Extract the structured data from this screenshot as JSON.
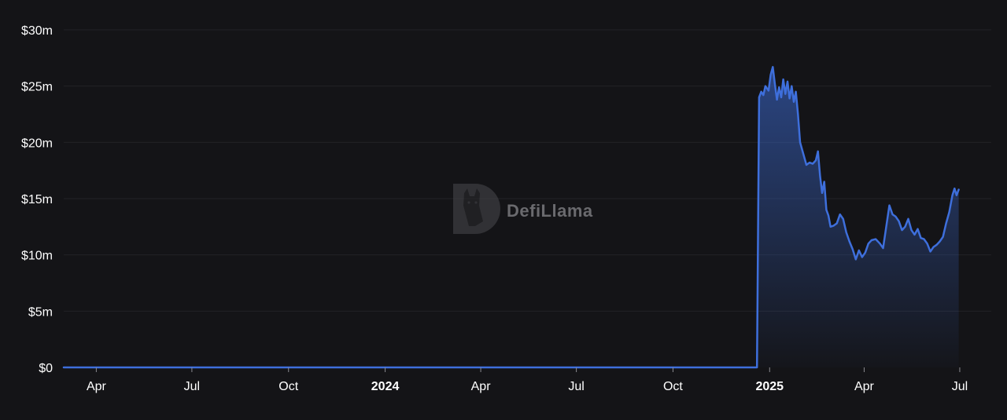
{
  "watermark": {
    "text": "DefiLlama",
    "logo": "llama-logo-icon"
  },
  "colors": {
    "background": "#141417",
    "line": "#3e6fdc",
    "grid": "#222227",
    "text": "#ffffff"
  },
  "chart_data": {
    "type": "area",
    "title": "",
    "xlabel": "",
    "ylabel": "",
    "y_unit": "$m",
    "ylim": [
      0,
      30
    ],
    "yticks": [
      {
        "value": 0,
        "label": "$0"
      },
      {
        "value": 5,
        "label": "$5m"
      },
      {
        "value": 10,
        "label": "$10m"
      },
      {
        "value": 15,
        "label": "$15m"
      },
      {
        "value": 20,
        "label": "$20m"
      },
      {
        "value": 25,
        "label": "$25m"
      },
      {
        "value": 30,
        "label": "$30m"
      }
    ],
    "xlim": [
      "2023-03-01",
      "2025-07-31"
    ],
    "xticks": [
      {
        "date": "2023-04-01",
        "label": "Apr",
        "bold": false
      },
      {
        "date": "2023-07-01",
        "label": "Jul",
        "bold": false
      },
      {
        "date": "2023-10-01",
        "label": "Oct",
        "bold": false
      },
      {
        "date": "2024-01-01",
        "label": "2024",
        "bold": true
      },
      {
        "date": "2024-04-01",
        "label": "Apr",
        "bold": false
      },
      {
        "date": "2024-07-01",
        "label": "Jul",
        "bold": false
      },
      {
        "date": "2024-10-01",
        "label": "Oct",
        "bold": false
      },
      {
        "date": "2025-01-01",
        "label": "2025",
        "bold": true
      },
      {
        "date": "2025-04-01",
        "label": "Apr",
        "bold": false
      },
      {
        "date": "2025-07-01",
        "label": "Jul",
        "bold": false
      }
    ],
    "grid": true,
    "legend": "none",
    "series": [
      {
        "points": [
          [
            "2023-03-01",
            0
          ],
          [
            "2024-12-20",
            0
          ],
          [
            "2024-12-22",
            24.0
          ],
          [
            "2024-12-24",
            24.5
          ],
          [
            "2024-12-26",
            24.2
          ],
          [
            "2024-12-28",
            25.0
          ],
          [
            "2024-12-31",
            24.6
          ],
          [
            "2025-01-02",
            26.0
          ],
          [
            "2025-01-04",
            26.7
          ],
          [
            "2025-01-06",
            25.2
          ],
          [
            "2025-01-08",
            23.8
          ],
          [
            "2025-01-10",
            24.9
          ],
          [
            "2025-01-12",
            24.0
          ],
          [
            "2025-01-14",
            25.6
          ],
          [
            "2025-01-16",
            24.3
          ],
          [
            "2025-01-18",
            25.4
          ],
          [
            "2025-01-20",
            23.9
          ],
          [
            "2025-01-22",
            25.0
          ],
          [
            "2025-01-24",
            23.6
          ],
          [
            "2025-01-26",
            24.5
          ],
          [
            "2025-01-28",
            22.5
          ],
          [
            "2025-01-30",
            20.0
          ],
          [
            "2025-02-02",
            19.0
          ],
          [
            "2025-02-05",
            18.0
          ],
          [
            "2025-02-08",
            18.2
          ],
          [
            "2025-02-11",
            18.1
          ],
          [
            "2025-02-14",
            18.4
          ],
          [
            "2025-02-16",
            19.2
          ],
          [
            "2025-02-18",
            17.0
          ],
          [
            "2025-02-20",
            15.5
          ],
          [
            "2025-02-22",
            16.5
          ],
          [
            "2025-02-24",
            14.0
          ],
          [
            "2025-02-26",
            13.5
          ],
          [
            "2025-02-28",
            12.5
          ],
          [
            "2025-03-03",
            12.6
          ],
          [
            "2025-03-06",
            12.8
          ],
          [
            "2025-03-09",
            13.6
          ],
          [
            "2025-03-12",
            13.2
          ],
          [
            "2025-03-15",
            12.0
          ],
          [
            "2025-03-18",
            11.2
          ],
          [
            "2025-03-21",
            10.5
          ],
          [
            "2025-03-24",
            9.6
          ],
          [
            "2025-03-27",
            10.4
          ],
          [
            "2025-03-30",
            9.8
          ],
          [
            "2025-04-02",
            10.2
          ],
          [
            "2025-04-05",
            11.0
          ],
          [
            "2025-04-08",
            11.3
          ],
          [
            "2025-04-12",
            11.4
          ],
          [
            "2025-04-16",
            11.0
          ],
          [
            "2025-04-19",
            10.6
          ],
          [
            "2025-04-22",
            12.5
          ],
          [
            "2025-04-25",
            14.4
          ],
          [
            "2025-04-28",
            13.6
          ],
          [
            "2025-05-01",
            13.4
          ],
          [
            "2025-05-04",
            13.0
          ],
          [
            "2025-05-07",
            12.2
          ],
          [
            "2025-05-10",
            12.5
          ],
          [
            "2025-05-13",
            13.2
          ],
          [
            "2025-05-16",
            12.2
          ],
          [
            "2025-05-19",
            11.8
          ],
          [
            "2025-05-22",
            12.3
          ],
          [
            "2025-05-25",
            11.5
          ],
          [
            "2025-05-28",
            11.4
          ],
          [
            "2025-05-31",
            11.0
          ],
          [
            "2025-06-03",
            10.3
          ],
          [
            "2025-06-06",
            10.7
          ],
          [
            "2025-06-09",
            10.9
          ],
          [
            "2025-06-12",
            11.2
          ],
          [
            "2025-06-15",
            11.6
          ],
          [
            "2025-06-18",
            12.8
          ],
          [
            "2025-06-21",
            13.8
          ],
          [
            "2025-06-24",
            15.3
          ],
          [
            "2025-06-26",
            15.9
          ],
          [
            "2025-06-28",
            15.3
          ],
          [
            "2025-06-30",
            15.8
          ]
        ]
      }
    ]
  }
}
